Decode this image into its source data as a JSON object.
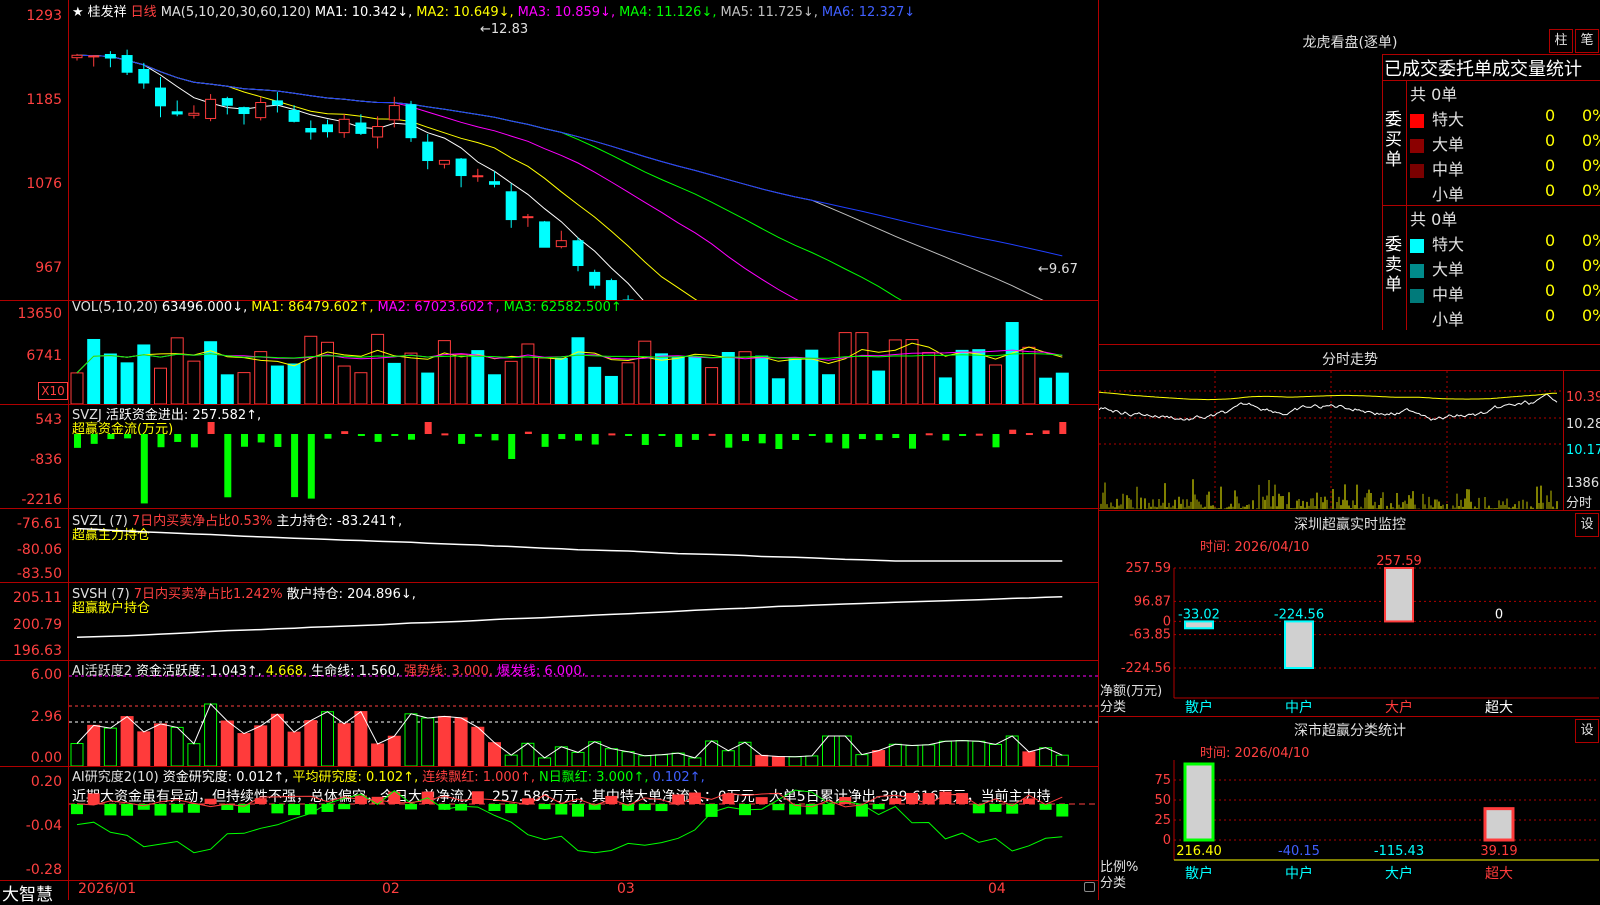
{
  "app": {
    "brand": "大智慧"
  },
  "main_pane": {
    "star": "★",
    "name": "桂发祥",
    "period": "日线",
    "ma_params": "MA(5,10,20,30,60,120)",
    "ma1": "MA1: 10.342↓,",
    "ma2": "MA2: 10.649↓,",
    "ma3": "MA3: 10.859↓,",
    "ma4": "MA4: 11.126↓,",
    "ma5": "MA5: 11.725↓,",
    "ma6": "MA6: 12.327↓",
    "y_labels": [
      "1293",
      "1185",
      "1076",
      "967"
    ],
    "high_marker": "←12.83",
    "low_marker": "←9.67"
  },
  "vol_pane": {
    "label": "VOL(5,10,20)",
    "val": "63496.000↓,",
    "ma1": "MA1: 86479.602↑,",
    "ma2": "MA2: 67023.602↑,",
    "ma3": "MA3: 62582.500↑",
    "y_labels": [
      "13650",
      "6741"
    ],
    "unit": "X10"
  },
  "svzj_pane": {
    "label": "SVZJ",
    "title": "活跃资金进出: 257.582↑,",
    "subtitle": "超赢资金流(万元)",
    "y_labels": [
      "543",
      "-836",
      "-2216"
    ]
  },
  "svzl_pane": {
    "label": "SVZL (7)",
    "text1": "7日内买卖净占比0.53%",
    "text2": "主力持仓: -83.241↑,",
    "subtitle": "超赢主力持仓",
    "y_labels": [
      "-76.61",
      "-80.06",
      "-83.50"
    ]
  },
  "svsh_pane": {
    "label": "SVSH (7)",
    "text1": "7日内买卖净占比1.242%",
    "text2": "散户持仓: 204.896↓,",
    "subtitle": "超赢散户持仓",
    "y_labels": [
      "205.11",
      "200.79",
      "196.63"
    ]
  },
  "ai1_pane": {
    "label": "AI活跃度2",
    "t1": "资金活跃度: 1.043↑,",
    "t2": "4.668,",
    "t3": "生命线: 1.560,",
    "t4": "强势线: 3.000,",
    "t5": "爆发线: 6.000,",
    "y_labels": [
      "6.00",
      "2.96",
      "0.00"
    ]
  },
  "ai2_pane": {
    "label": "AI研究度2(10)",
    "t1": "资金研究度: 0.012↑,",
    "t2": "平均研究度: 0.102↑,",
    "t3": "连续飘红: 1.000↑,",
    "t4": "N日飘红: 3.000↑,",
    "t5": "0.102↑,",
    "message": "近期大资金虽有异动，但持续性不强，总体偏空，今日大单净流入：257.586万元，其中特大单净流入：0万元，大单5日累计净出-389.616万元，当前主力持",
    "y_labels": [
      "0.20",
      "-0.04",
      "-0.28"
    ]
  },
  "x_axis": {
    "labels": [
      "2026/01",
      "02",
      "03",
      "04"
    ]
  },
  "dragon": {
    "title": "龙虎看盘(逐单)",
    "btn_bar": "柱",
    "btn_pen": "笔",
    "header": "已成交委托单成交量统计",
    "buy_side": "委买单",
    "sell_side": "委卖单",
    "total": "共 0单",
    "rows": [
      "特大",
      "大单",
      "中单",
      "小单"
    ],
    "value": "0",
    "pct": "0%",
    "buy_colors": [
      "#ff0000",
      "#8b0000",
      "#7a0000",
      "#000000"
    ],
    "sell_colors": [
      "#00ffff",
      "#008b8b",
      "#007a7a",
      "#000000"
    ]
  },
  "intraday": {
    "title": "分时走势",
    "y_labels": [
      "10.39",
      "10.28",
      "10.17"
    ],
    "vol_label": "1386",
    "unit": "分时"
  },
  "realtime": {
    "title": "深圳超赢实时监控",
    "set_btn": "设",
    "time": "时间: 2026/04/10",
    "y_labels": [
      "257.59",
      "96.87",
      "0",
      "-63.85",
      "-224.56"
    ],
    "net_label": "净额(万元)",
    "cat_label": "分类",
    "categories": [
      "散户",
      "中户",
      "大户",
      "超大"
    ],
    "values": [
      -33.02,
      -224.56,
      257.59,
      0
    ],
    "value_labels": [
      "-33.02",
      "-224.56",
      "257.59",
      "0"
    ]
  },
  "class_stats": {
    "title": "深市超赢分类统计",
    "set_btn": "设",
    "time": "时间: 2026/04/10",
    "y_labels": [
      "75",
      "50",
      "25",
      "0"
    ],
    "ratio_label": "比例%",
    "cat_label": "分类",
    "categories": [
      "散户",
      "中户",
      "大户",
      "超大"
    ],
    "values": [
      216.4,
      -40.15,
      -115.43,
      39.19
    ],
    "value_labels": [
      "216.40",
      "-40.15",
      "-115.43",
      "39.19"
    ]
  },
  "colors": {
    "up": "#ff3b3b",
    "down": "#00ffff",
    "grid": "#b00000",
    "ma1": "#ffffff",
    "ma2": "#ffff00",
    "ma3": "#ff00ff",
    "ma4": "#00ff00",
    "ma5": "#c0c0c0",
    "ma6": "#2040ff"
  }
}
